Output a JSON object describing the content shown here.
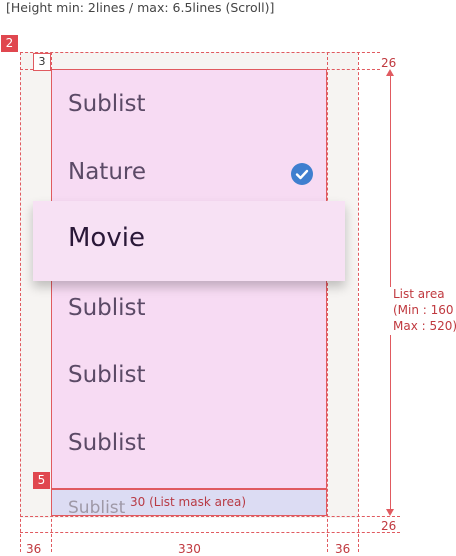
{
  "header": {
    "caption": "[Height min: 2lines / max: 6.5lines (Scroll)]"
  },
  "badges": {
    "b2": "2",
    "b3": "3",
    "b5": "5"
  },
  "list": {
    "items": [
      {
        "label": "Sublist"
      },
      {
        "label": "Nature"
      },
      {
        "label": "Movie"
      },
      {
        "label": "Sublist"
      },
      {
        "label": "Sublist"
      },
      {
        "label": "Sublist"
      }
    ],
    "mask_text": "Sublist"
  },
  "annotations": {
    "mask_area": "30 (List mask area)",
    "list_area": [
      "List area",
      "(Min : 160",
      "Max : 520)"
    ],
    "top_margin": "26",
    "bottom_margin": "26",
    "left_margin": "36",
    "width": "330",
    "right_margin": "36"
  },
  "colors": {
    "list_bg": "#f7dbf3",
    "mask_bg": "#dcdcf3",
    "redline": "#e05a60",
    "check": "#3f7fcf"
  },
  "icons": {
    "check": "check-circle-icon"
  }
}
